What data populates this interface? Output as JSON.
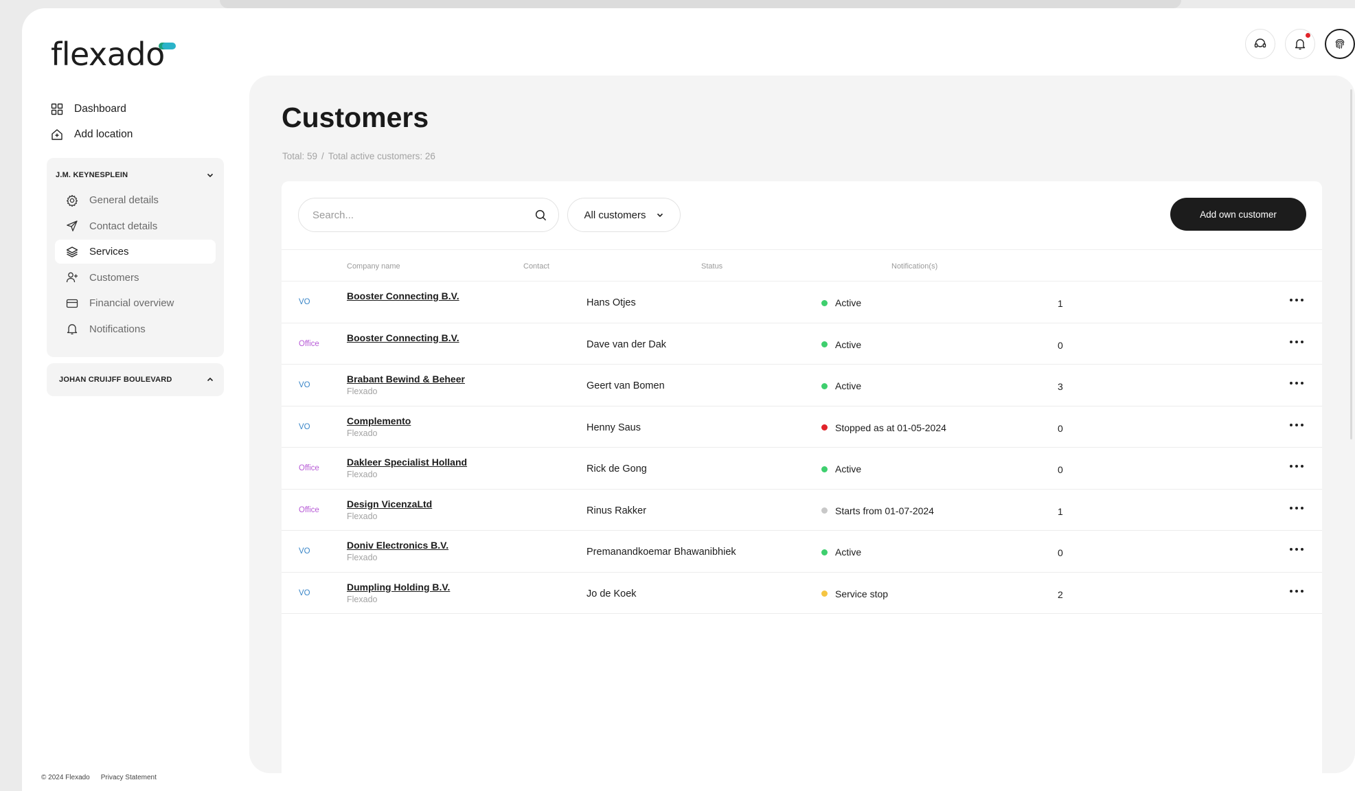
{
  "brand": {
    "logo_text": "flexado"
  },
  "topnav": {
    "items": [
      {
        "label": "Dashboard",
        "icon": "dashboard-grid-icon"
      },
      {
        "label": "Add location",
        "icon": "add-location-icon"
      }
    ]
  },
  "locations": [
    {
      "name": "J.M. KEYNESPLEIN",
      "expanded": true,
      "items": [
        {
          "label": "General details",
          "icon": "gear-icon"
        },
        {
          "label": "Contact details",
          "icon": "send-icon"
        },
        {
          "label": "Services",
          "icon": "layers-icon",
          "active": true
        },
        {
          "label": "Customers",
          "icon": "add-user-icon"
        },
        {
          "label": "Financial overview",
          "icon": "credit-card-icon"
        },
        {
          "label": "Notifications",
          "icon": "bell-icon"
        }
      ]
    },
    {
      "name": "JOHAN CRUIJFF BOULEVARD",
      "expanded": false
    }
  ],
  "footer": {
    "copyright": "© 2024 Flexado",
    "privacy": "Privacy Statement"
  },
  "header": {
    "icons": [
      "support-headset-icon",
      "bell-icon",
      "fingerprint-icon"
    ],
    "notification_dot_color": "#e1242a"
  },
  "page": {
    "title": "Customers",
    "total": "Total: 59",
    "separator": "/",
    "total_active": "Total active customers: 26"
  },
  "toolbar": {
    "search_placeholder": "Search...",
    "filter_label": "All customers",
    "add_button": "Add own customer"
  },
  "table": {
    "columns": {
      "company": "Company name",
      "contact": "Contact",
      "status": "Status",
      "notifications": "Notification(s)"
    },
    "rows": [
      {
        "type": "VO",
        "company": "Booster Connecting B.V.",
        "sub": "",
        "contact": "Hans Otjes",
        "status": "Active",
        "status_color": "#3ecf6e",
        "notifications": "1"
      },
      {
        "type": "Office",
        "company": "Booster Connecting B.V.",
        "sub": "",
        "contact": "Dave van der Dak",
        "status": "Active",
        "status_color": "#3ecf6e",
        "notifications": "0"
      },
      {
        "type": "VO",
        "company": "Brabant Bewind & Beheer",
        "sub": "Flexado",
        "contact": "Geert van Bomen",
        "status": "Active",
        "status_color": "#3ecf6e",
        "notifications": "3"
      },
      {
        "type": "VO",
        "company": "Complemento",
        "sub": "Flexado",
        "contact": "Henny Saus",
        "status": "Stopped as at 01-05-2024",
        "status_color": "#e1242a",
        "notifications": "0"
      },
      {
        "type": "Office",
        "company": "Dakleer Specialist Holland",
        "sub": "Flexado",
        "contact": "Rick de Gong",
        "status": "Active",
        "status_color": "#3ecf6e",
        "notifications": "0"
      },
      {
        "type": "Office",
        "company": "Design VicenzaLtd",
        "sub": "Flexado",
        "contact": "Rinus Rakker",
        "status": "Starts from 01-07-2024",
        "status_color": "#c8c8c8",
        "notifications": "1"
      },
      {
        "type": "VO",
        "company": "Doniv Electronics B.V.",
        "sub": "Flexado",
        "contact": "Premanandkoemar Bhawanibhiek",
        "status": "Active",
        "status_color": "#3ecf6e",
        "notifications": "0"
      },
      {
        "type": "VO",
        "company": "Dumpling Holding B.V.",
        "sub": "Flexado",
        "contact": "Jo de Koek",
        "status": "Service stop",
        "status_color": "#f5c542",
        "notifications": "2"
      }
    ]
  }
}
